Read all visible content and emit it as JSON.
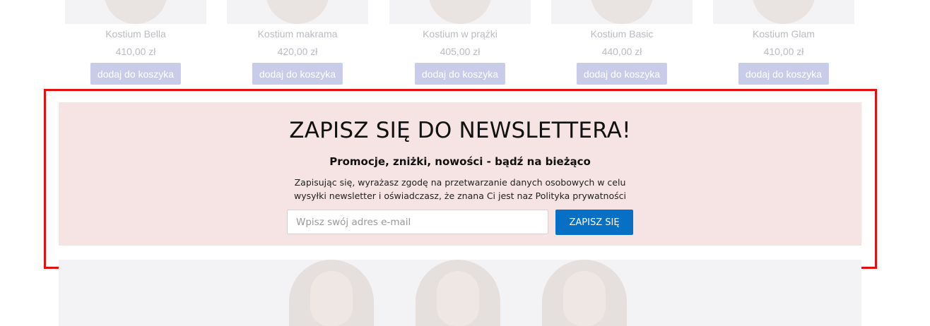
{
  "products": [
    {
      "name": "Kostium Bella",
      "price": "410,00 zł",
      "button": "dodaj do koszyka"
    },
    {
      "name": "Kostium makrama",
      "price": "420,00 zł",
      "button": "dodaj do koszyka"
    },
    {
      "name": "Kostium w prążki",
      "price": "405,00 zł",
      "button": "dodaj do koszyka"
    },
    {
      "name": "Kostium Basic",
      "price": "440,00 zł",
      "button": "dodaj do koszyka"
    },
    {
      "name": "Kostium Glam",
      "price": "410,00 zł",
      "button": "dodaj do koszyka"
    }
  ],
  "newsletter": {
    "title": "ZAPISZ SIĘ DO NEWSLETTERA!",
    "subtitle": "Promocje, zniżki, nowości - bądź na bieżąco",
    "consent_line1": "Zapisując się, wyrażasz zgodę na przetwarzanie danych osobowych w celu",
    "consent_line2": "wysyłki newsletter i oświadczasz, że znana Ci jest naz Polityka prywatności",
    "email_placeholder": "Wpisz swój adres e-mail",
    "email_value": "",
    "submit_label": "ZAPISZ SIĘ"
  },
  "colors": {
    "newsletter_bg": "#f5e4e3",
    "submit_bg": "#0770c4",
    "cart_button_bg": "#c8cce8",
    "highlight": "#e41010"
  }
}
